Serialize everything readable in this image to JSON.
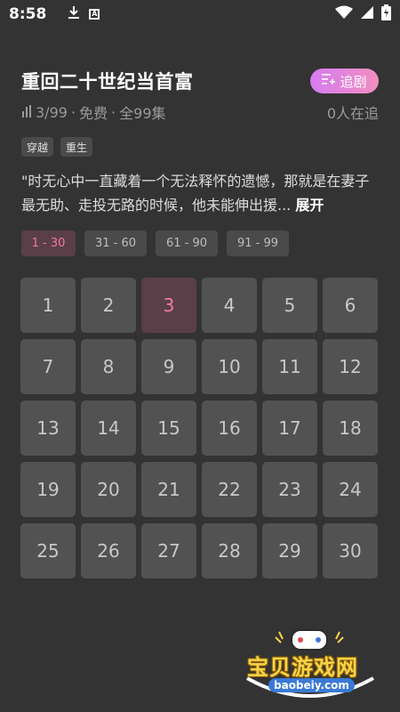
{
  "status_bar": {
    "time": "8:58"
  },
  "header": {
    "title": "重回二十世纪当首富",
    "follow_label": "追剧"
  },
  "meta": {
    "progress": "3/99",
    "price": "免费",
    "total": "全99集",
    "separator": "·",
    "watchers": "0人在追"
  },
  "tags": [
    "穿越",
    "重生"
  ],
  "description": {
    "text": "\"时无心中一直藏着一个无法释怀的遗憾，那就是在妻子最无助、走投无路的时候，他未能伸出援...",
    "expand_label": "展开"
  },
  "ranges": [
    "1 - 30",
    "31 - 60",
    "61 - 90",
    "91 - 99"
  ],
  "active_range": 0,
  "episodes": [
    "1",
    "2",
    "3",
    "4",
    "5",
    "6",
    "7",
    "8",
    "9",
    "10",
    "11",
    "12",
    "13",
    "14",
    "15",
    "16",
    "17",
    "18",
    "19",
    "20",
    "21",
    "22",
    "23",
    "24",
    "25",
    "26",
    "27",
    "28",
    "29",
    "30"
  ],
  "active_episode": 3,
  "watermark": {
    "name": "宝贝游戏网",
    "url": "baobeiy.com"
  },
  "colors": {
    "background": "#333333",
    "accent": "#f27aa0",
    "follow_gradient_start": "#d57cf0",
    "follow_gradient_end": "#f28ec0"
  }
}
